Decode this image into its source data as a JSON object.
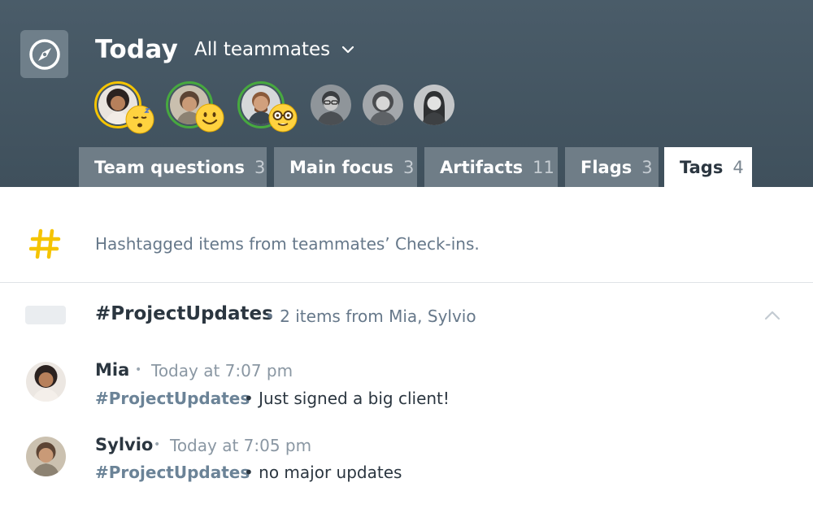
{
  "header": {
    "title": "Today",
    "filter_label": "All teammates",
    "avatars": [
      {
        "name": "teammate-1",
        "ring": "#f5c400",
        "emoji": "sleepy"
      },
      {
        "name": "teammate-2",
        "ring": "#47a93f",
        "emoji": "smile"
      },
      {
        "name": "teammate-3",
        "ring": "#47a93f",
        "emoji": "nerd"
      },
      {
        "name": "teammate-4",
        "ring": "none",
        "emoji": "none"
      },
      {
        "name": "teammate-5",
        "ring": "none",
        "emoji": "none"
      },
      {
        "name": "teammate-6",
        "ring": "none",
        "emoji": "none"
      }
    ]
  },
  "tabs": [
    {
      "label": "Team questions",
      "count": "3",
      "active": false
    },
    {
      "label": "Main focus",
      "count": "3",
      "active": false
    },
    {
      "label": "Artifacts",
      "count": "11",
      "active": false
    },
    {
      "label": "Flags",
      "count": "3",
      "active": false
    },
    {
      "label": "Tags",
      "count": "4",
      "active": true
    }
  ],
  "banner": {
    "icon": "hashtag-icon",
    "text": "Hashtagged items from teammates’ Check-ins."
  },
  "group": {
    "title": "#ProjectUpdates",
    "meta": "• 2 items from Mia, Sylvio"
  },
  "entries": [
    {
      "name": "Mia",
      "separator": "•",
      "time": "Today at 7:07 pm",
      "tag": "#ProjectUpdates",
      "text": "• Just signed a big client!"
    },
    {
      "name": "Sylvio",
      "separator": "•",
      "time": "Today at 7:05 pm",
      "tag": "#ProjectUpdates",
      "text": "• no major updates"
    }
  ],
  "colors": {
    "header_bg": "#46586a",
    "tab_bg": "#6f7d87",
    "accent_yellow": "#f5c400",
    "ring_green": "#47a93f",
    "tag_color": "#6b8397"
  }
}
